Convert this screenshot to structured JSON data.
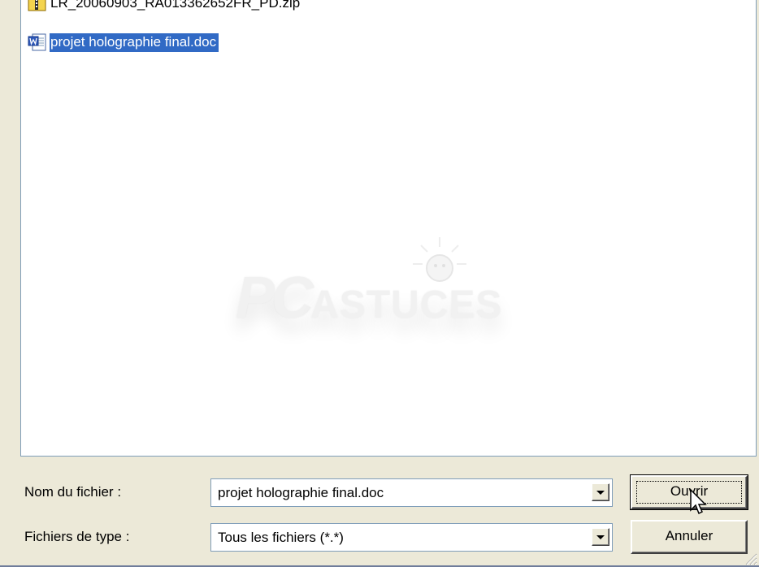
{
  "file_list": {
    "items": [
      {
        "name": "LR_20060903_RA013362652FR_PD.zip",
        "icon": "zip-folder-icon",
        "selected": false
      },
      {
        "name": "projet holographie final.doc",
        "icon": "word-document-icon",
        "selected": true
      }
    ]
  },
  "watermark": {
    "text_big": "PC",
    "text_small": "ASTUCES"
  },
  "form": {
    "file_name_label": "Nom du fichier :",
    "file_name_value": "projet holographie final.doc",
    "file_type_label": "Fichiers de type :",
    "file_type_value": "Tous les fichiers (*.*)"
  },
  "buttons": {
    "open_label": "Ouvrir",
    "cancel_label": "Annuler"
  },
  "colors": {
    "dialog_background": "#ECE9D8",
    "selection": "#316AC5",
    "field_border": "#7F9DB9"
  }
}
